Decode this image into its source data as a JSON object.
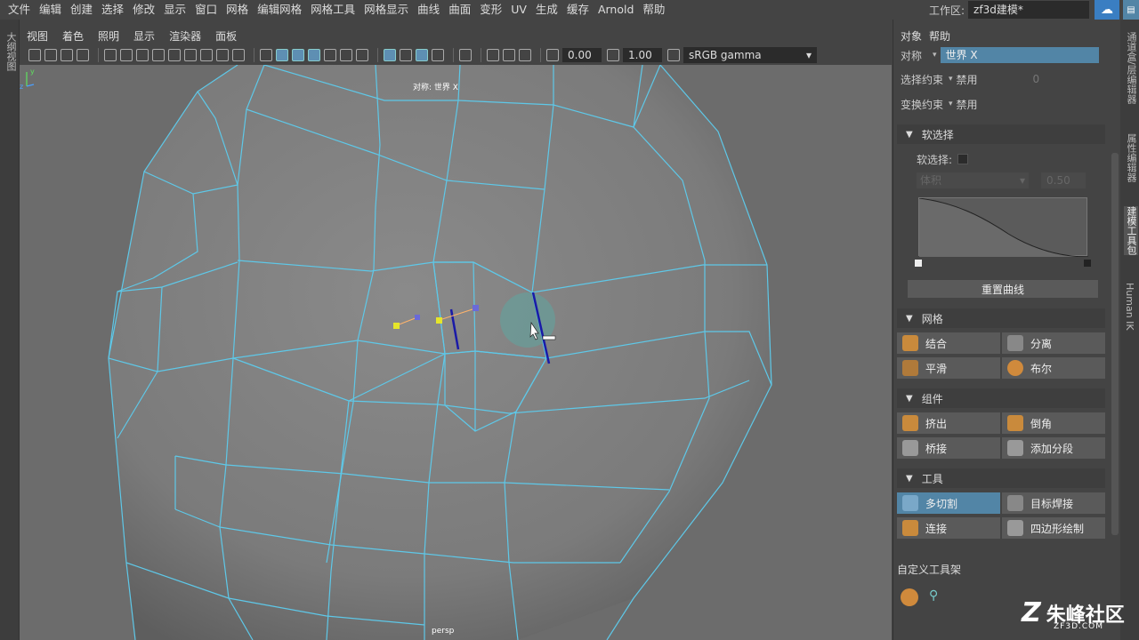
{
  "menubar": {
    "items": [
      "文件",
      "编辑",
      "创建",
      "选择",
      "修改",
      "显示",
      "窗口",
      "网格",
      "编辑网格",
      "网格工具",
      "网格显示",
      "曲线",
      "曲面",
      "变形",
      "UV",
      "生成",
      "缓存",
      "Arnold",
      "帮助"
    ],
    "workspace_label": "工作区:",
    "workspace_value": "zf3d建模*"
  },
  "left_tab": "大纲视图",
  "viewport_menu": [
    "视图",
    "着色",
    "照明",
    "显示",
    "渲染器",
    "面板"
  ],
  "viewport_toolbar": {
    "exposure": "0.00",
    "gamma": "1.00",
    "colorspace": "sRGB gamma"
  },
  "viewport": {
    "symmetry_label": "对称: 世界 X",
    "camera_label": "persp",
    "axis_labels": {
      "y": "y",
      "z": "z"
    }
  },
  "right_panel": {
    "menu": [
      "对象",
      "帮助"
    ],
    "symmetry": {
      "label": "对称",
      "value": "世界 X"
    },
    "select_constraint": {
      "label": "选择约束",
      "value": "禁用",
      "num": "0"
    },
    "transform_constraint": {
      "label": "变换约束",
      "value": "禁用"
    },
    "soft_select": {
      "section": "软选择",
      "checkbox_label": "软选择:",
      "falloff_mode": "体积",
      "radius": "0.50",
      "reset_button": "重置曲线"
    },
    "sections": {
      "mesh": {
        "title": "网格",
        "buttons": [
          "结合",
          "分离",
          "平滑",
          "布尔"
        ]
      },
      "component": {
        "title": "组件",
        "buttons": [
          "挤出",
          "倒角",
          "桥接",
          "添加分段"
        ]
      },
      "tools": {
        "title": "工具",
        "buttons": [
          "多切割",
          "目标焊接",
          "连接",
          "四边形绘制"
        ]
      }
    },
    "custom_shelf": "自定义工具架"
  },
  "right_tabs": [
    "通道盒/层编辑器",
    "属性编辑器",
    "建模工具包",
    "Human IK"
  ],
  "watermark": {
    "name": "朱峰社区",
    "url": "ZF3D.COM"
  },
  "colors": {
    "wire": "#5ec8e8",
    "active": "#5285a6",
    "cut_line": "#1a1aa8",
    "mesh": "#6f6f6f"
  }
}
